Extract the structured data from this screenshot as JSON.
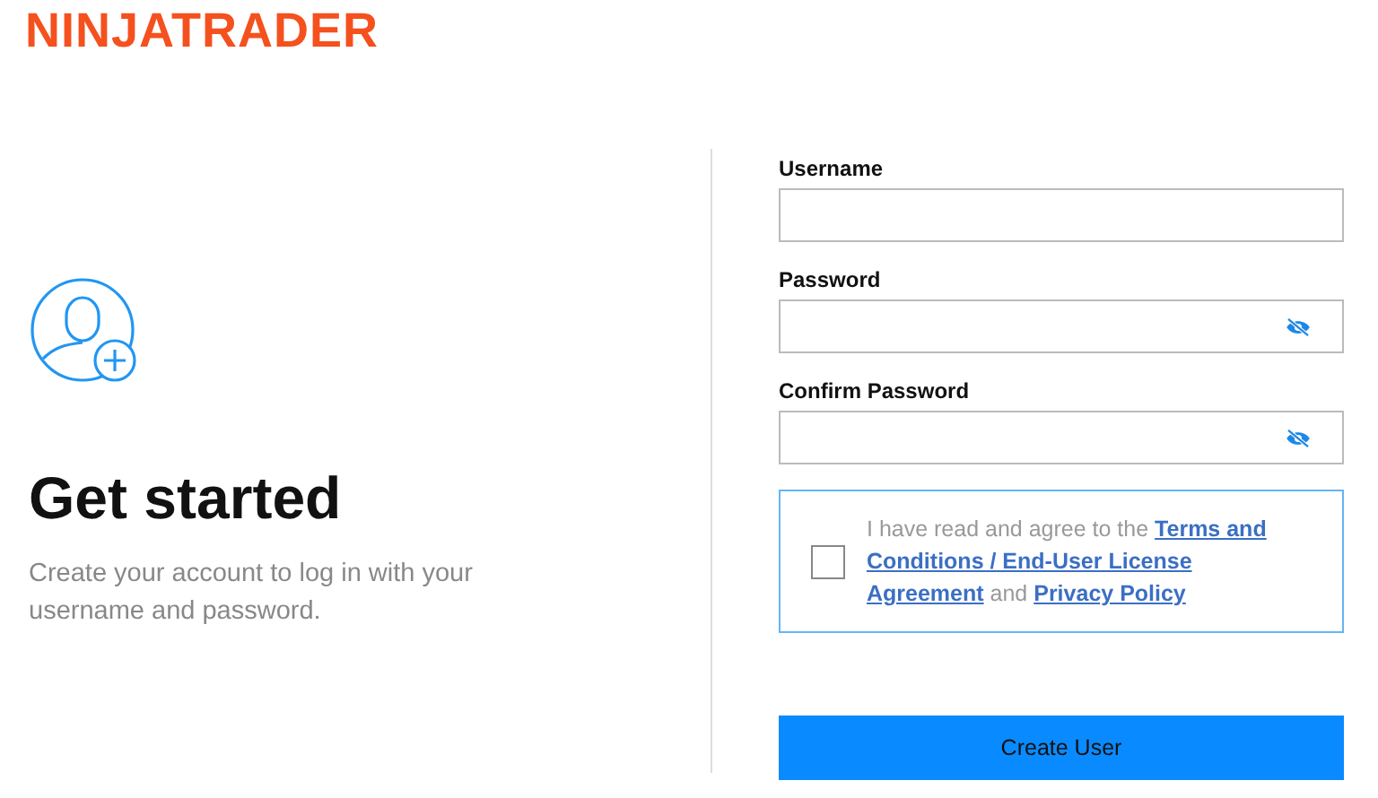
{
  "logo": "NINJATRADER",
  "intro": {
    "title": "Get started",
    "subtitle": "Create your account to log in with your username and password."
  },
  "fields": [
    {
      "label": "Username",
      "kind": "text"
    },
    {
      "label": "Password",
      "kind": "password"
    },
    {
      "label": "Confirm Password",
      "kind": "password"
    }
  ],
  "agreement": {
    "checked": false,
    "parts": [
      {
        "text": "I have read and agree to the ",
        "kind": "text"
      },
      {
        "text": "Terms and",
        "kind": "link"
      },
      {
        "text": "Conditions / End-User License",
        "kind": "link"
      },
      {
        "text": "Agreement",
        "kind": "link"
      },
      {
        "text": " and ",
        "kind": "text"
      },
      {
        "text": "Privacy Policy",
        "kind": "link"
      }
    ]
  },
  "submit": "Create User"
}
